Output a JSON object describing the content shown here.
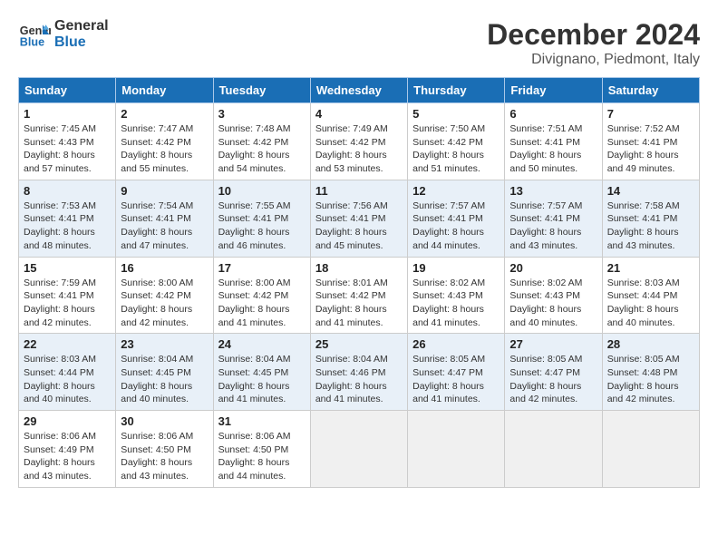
{
  "header": {
    "logo_line1": "General",
    "logo_line2": "Blue",
    "month_title": "December 2024",
    "subtitle": "Divignano, Piedmont, Italy"
  },
  "days_of_week": [
    "Sunday",
    "Monday",
    "Tuesday",
    "Wednesday",
    "Thursday",
    "Friday",
    "Saturday"
  ],
  "weeks": [
    [
      {
        "day": "1",
        "sunrise": "Sunrise: 7:45 AM",
        "sunset": "Sunset: 4:43 PM",
        "daylight": "Daylight: 8 hours and 57 minutes."
      },
      {
        "day": "2",
        "sunrise": "Sunrise: 7:47 AM",
        "sunset": "Sunset: 4:42 PM",
        "daylight": "Daylight: 8 hours and 55 minutes."
      },
      {
        "day": "3",
        "sunrise": "Sunrise: 7:48 AM",
        "sunset": "Sunset: 4:42 PM",
        "daylight": "Daylight: 8 hours and 54 minutes."
      },
      {
        "day": "4",
        "sunrise": "Sunrise: 7:49 AM",
        "sunset": "Sunset: 4:42 PM",
        "daylight": "Daylight: 8 hours and 53 minutes."
      },
      {
        "day": "5",
        "sunrise": "Sunrise: 7:50 AM",
        "sunset": "Sunset: 4:42 PM",
        "daylight": "Daylight: 8 hours and 51 minutes."
      },
      {
        "day": "6",
        "sunrise": "Sunrise: 7:51 AM",
        "sunset": "Sunset: 4:41 PM",
        "daylight": "Daylight: 8 hours and 50 minutes."
      },
      {
        "day": "7",
        "sunrise": "Sunrise: 7:52 AM",
        "sunset": "Sunset: 4:41 PM",
        "daylight": "Daylight: 8 hours and 49 minutes."
      }
    ],
    [
      {
        "day": "8",
        "sunrise": "Sunrise: 7:53 AM",
        "sunset": "Sunset: 4:41 PM",
        "daylight": "Daylight: 8 hours and 48 minutes."
      },
      {
        "day": "9",
        "sunrise": "Sunrise: 7:54 AM",
        "sunset": "Sunset: 4:41 PM",
        "daylight": "Daylight: 8 hours and 47 minutes."
      },
      {
        "day": "10",
        "sunrise": "Sunrise: 7:55 AM",
        "sunset": "Sunset: 4:41 PM",
        "daylight": "Daylight: 8 hours and 46 minutes."
      },
      {
        "day": "11",
        "sunrise": "Sunrise: 7:56 AM",
        "sunset": "Sunset: 4:41 PM",
        "daylight": "Daylight: 8 hours and 45 minutes."
      },
      {
        "day": "12",
        "sunrise": "Sunrise: 7:57 AM",
        "sunset": "Sunset: 4:41 PM",
        "daylight": "Daylight: 8 hours and 44 minutes."
      },
      {
        "day": "13",
        "sunrise": "Sunrise: 7:57 AM",
        "sunset": "Sunset: 4:41 PM",
        "daylight": "Daylight: 8 hours and 43 minutes."
      },
      {
        "day": "14",
        "sunrise": "Sunrise: 7:58 AM",
        "sunset": "Sunset: 4:41 PM",
        "daylight": "Daylight: 8 hours and 43 minutes."
      }
    ],
    [
      {
        "day": "15",
        "sunrise": "Sunrise: 7:59 AM",
        "sunset": "Sunset: 4:41 PM",
        "daylight": "Daylight: 8 hours and 42 minutes."
      },
      {
        "day": "16",
        "sunrise": "Sunrise: 8:00 AM",
        "sunset": "Sunset: 4:42 PM",
        "daylight": "Daylight: 8 hours and 42 minutes."
      },
      {
        "day": "17",
        "sunrise": "Sunrise: 8:00 AM",
        "sunset": "Sunset: 4:42 PM",
        "daylight": "Daylight: 8 hours and 41 minutes."
      },
      {
        "day": "18",
        "sunrise": "Sunrise: 8:01 AM",
        "sunset": "Sunset: 4:42 PM",
        "daylight": "Daylight: 8 hours and 41 minutes."
      },
      {
        "day": "19",
        "sunrise": "Sunrise: 8:02 AM",
        "sunset": "Sunset: 4:43 PM",
        "daylight": "Daylight: 8 hours and 41 minutes."
      },
      {
        "day": "20",
        "sunrise": "Sunrise: 8:02 AM",
        "sunset": "Sunset: 4:43 PM",
        "daylight": "Daylight: 8 hours and 40 minutes."
      },
      {
        "day": "21",
        "sunrise": "Sunrise: 8:03 AM",
        "sunset": "Sunset: 4:44 PM",
        "daylight": "Daylight: 8 hours and 40 minutes."
      }
    ],
    [
      {
        "day": "22",
        "sunrise": "Sunrise: 8:03 AM",
        "sunset": "Sunset: 4:44 PM",
        "daylight": "Daylight: 8 hours and 40 minutes."
      },
      {
        "day": "23",
        "sunrise": "Sunrise: 8:04 AM",
        "sunset": "Sunset: 4:45 PM",
        "daylight": "Daylight: 8 hours and 40 minutes."
      },
      {
        "day": "24",
        "sunrise": "Sunrise: 8:04 AM",
        "sunset": "Sunset: 4:45 PM",
        "daylight": "Daylight: 8 hours and 41 minutes."
      },
      {
        "day": "25",
        "sunrise": "Sunrise: 8:04 AM",
        "sunset": "Sunset: 4:46 PM",
        "daylight": "Daylight: 8 hours and 41 minutes."
      },
      {
        "day": "26",
        "sunrise": "Sunrise: 8:05 AM",
        "sunset": "Sunset: 4:47 PM",
        "daylight": "Daylight: 8 hours and 41 minutes."
      },
      {
        "day": "27",
        "sunrise": "Sunrise: 8:05 AM",
        "sunset": "Sunset: 4:47 PM",
        "daylight": "Daylight: 8 hours and 42 minutes."
      },
      {
        "day": "28",
        "sunrise": "Sunrise: 8:05 AM",
        "sunset": "Sunset: 4:48 PM",
        "daylight": "Daylight: 8 hours and 42 minutes."
      }
    ],
    [
      {
        "day": "29",
        "sunrise": "Sunrise: 8:06 AM",
        "sunset": "Sunset: 4:49 PM",
        "daylight": "Daylight: 8 hours and 43 minutes."
      },
      {
        "day": "30",
        "sunrise": "Sunrise: 8:06 AM",
        "sunset": "Sunset: 4:50 PM",
        "daylight": "Daylight: 8 hours and 43 minutes."
      },
      {
        "day": "31",
        "sunrise": "Sunrise: 8:06 AM",
        "sunset": "Sunset: 4:50 PM",
        "daylight": "Daylight: 8 hours and 44 minutes."
      },
      null,
      null,
      null,
      null
    ]
  ]
}
